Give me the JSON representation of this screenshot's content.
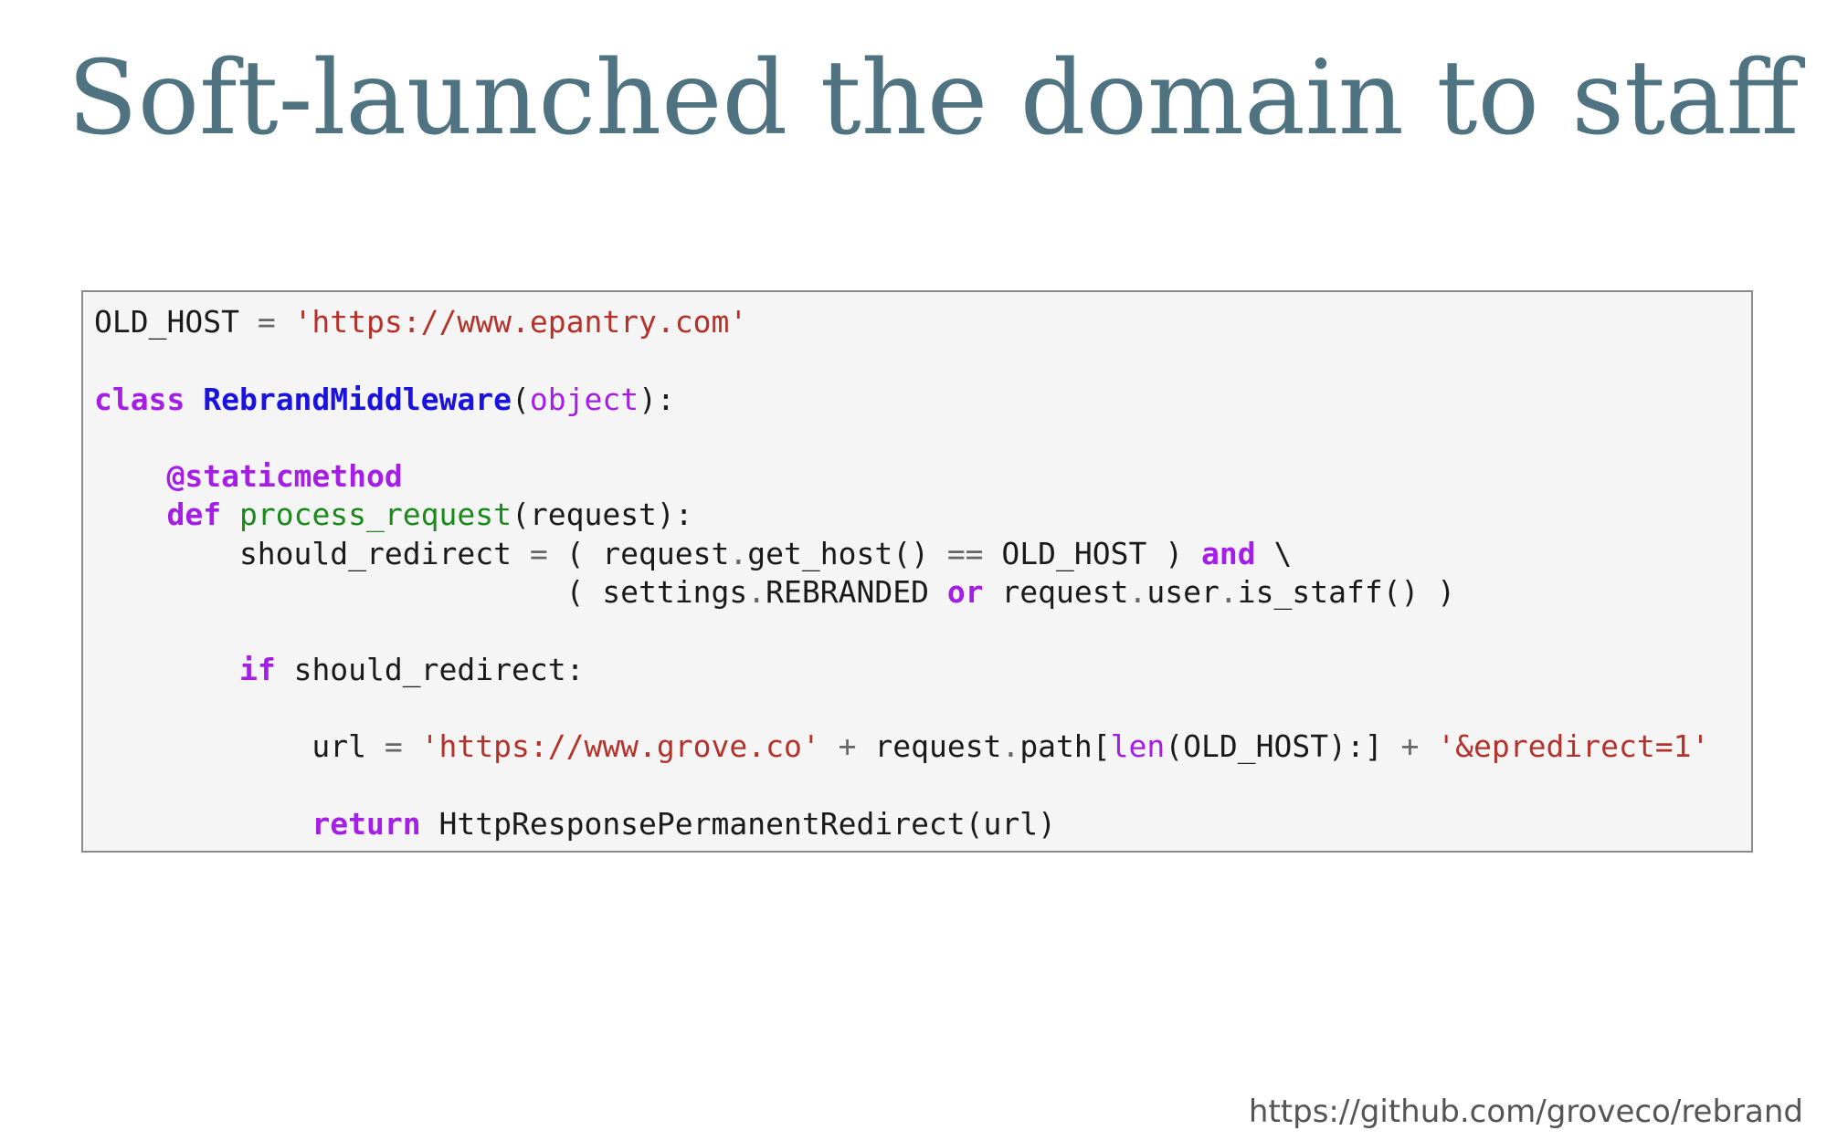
{
  "slide": {
    "title": "Soft-launched the domain to staff",
    "source_url": "https://github.com/groveco/rebrand"
  },
  "colors": {
    "title": "#4f7380",
    "string": "#b5322b",
    "keyword": "#a51ee8",
    "class_name": "#1a12e0",
    "function_name": "#1a8a1a",
    "text": "#1a1a1a",
    "panel_background": "#f5f5f5",
    "panel_border": "#8a8a8a"
  },
  "code": {
    "language": "python",
    "lines": [
      [
        {
          "t": "txt",
          "v": "OLD_HOST "
        },
        {
          "t": "op",
          "v": "="
        },
        {
          "t": "txt",
          "v": " "
        },
        {
          "t": "str",
          "v": "'https://www.epantry.com'"
        }
      ],
      [],
      [
        {
          "t": "kw",
          "v": "class"
        },
        {
          "t": "txt",
          "v": " "
        },
        {
          "t": "cls",
          "v": "RebrandMiddleware"
        },
        {
          "t": "txt",
          "v": "("
        },
        {
          "t": "builtin",
          "v": "object"
        },
        {
          "t": "txt",
          "v": "):"
        }
      ],
      [],
      [
        {
          "t": "txt",
          "v": "    "
        },
        {
          "t": "kw",
          "v": "@staticmethod"
        }
      ],
      [
        {
          "t": "txt",
          "v": "    "
        },
        {
          "t": "kw",
          "v": "def"
        },
        {
          "t": "txt",
          "v": " "
        },
        {
          "t": "fn",
          "v": "process_request"
        },
        {
          "t": "txt",
          "v": "(request):"
        }
      ],
      [
        {
          "t": "txt",
          "v": "        should_redirect "
        },
        {
          "t": "op",
          "v": "="
        },
        {
          "t": "txt",
          "v": " ( request"
        },
        {
          "t": "op",
          "v": "."
        },
        {
          "t": "txt",
          "v": "get_host() "
        },
        {
          "t": "op",
          "v": "=="
        },
        {
          "t": "txt",
          "v": " OLD_HOST ) "
        },
        {
          "t": "kw",
          "v": "and"
        },
        {
          "t": "txt",
          "v": " \\"
        }
      ],
      [
        {
          "t": "txt",
          "v": "                          ( settings"
        },
        {
          "t": "op",
          "v": "."
        },
        {
          "t": "txt",
          "v": "REBRANDED "
        },
        {
          "t": "kw",
          "v": "or"
        },
        {
          "t": "txt",
          "v": " request"
        },
        {
          "t": "op",
          "v": "."
        },
        {
          "t": "txt",
          "v": "user"
        },
        {
          "t": "op",
          "v": "."
        },
        {
          "t": "txt",
          "v": "is_staff() )"
        }
      ],
      [],
      [
        {
          "t": "txt",
          "v": "        "
        },
        {
          "t": "kw",
          "v": "if"
        },
        {
          "t": "txt",
          "v": " should_redirect:"
        }
      ],
      [],
      [
        {
          "t": "txt",
          "v": "            url "
        },
        {
          "t": "op",
          "v": "="
        },
        {
          "t": "txt",
          "v": " "
        },
        {
          "t": "str",
          "v": "'https://www.grove.co'"
        },
        {
          "t": "txt",
          "v": " "
        },
        {
          "t": "op",
          "v": "+"
        },
        {
          "t": "txt",
          "v": " request"
        },
        {
          "t": "op",
          "v": "."
        },
        {
          "t": "txt",
          "v": "path["
        },
        {
          "t": "builtin",
          "v": "len"
        },
        {
          "t": "txt",
          "v": "(OLD_HOST):] "
        },
        {
          "t": "op",
          "v": "+"
        },
        {
          "t": "txt",
          "v": " "
        },
        {
          "t": "str",
          "v": "'&epredirect=1'"
        }
      ],
      [],
      [
        {
          "t": "txt",
          "v": "            "
        },
        {
          "t": "kw",
          "v": "return"
        },
        {
          "t": "txt",
          "v": " HttpResponsePermanentRedirect(url)"
        }
      ]
    ]
  }
}
